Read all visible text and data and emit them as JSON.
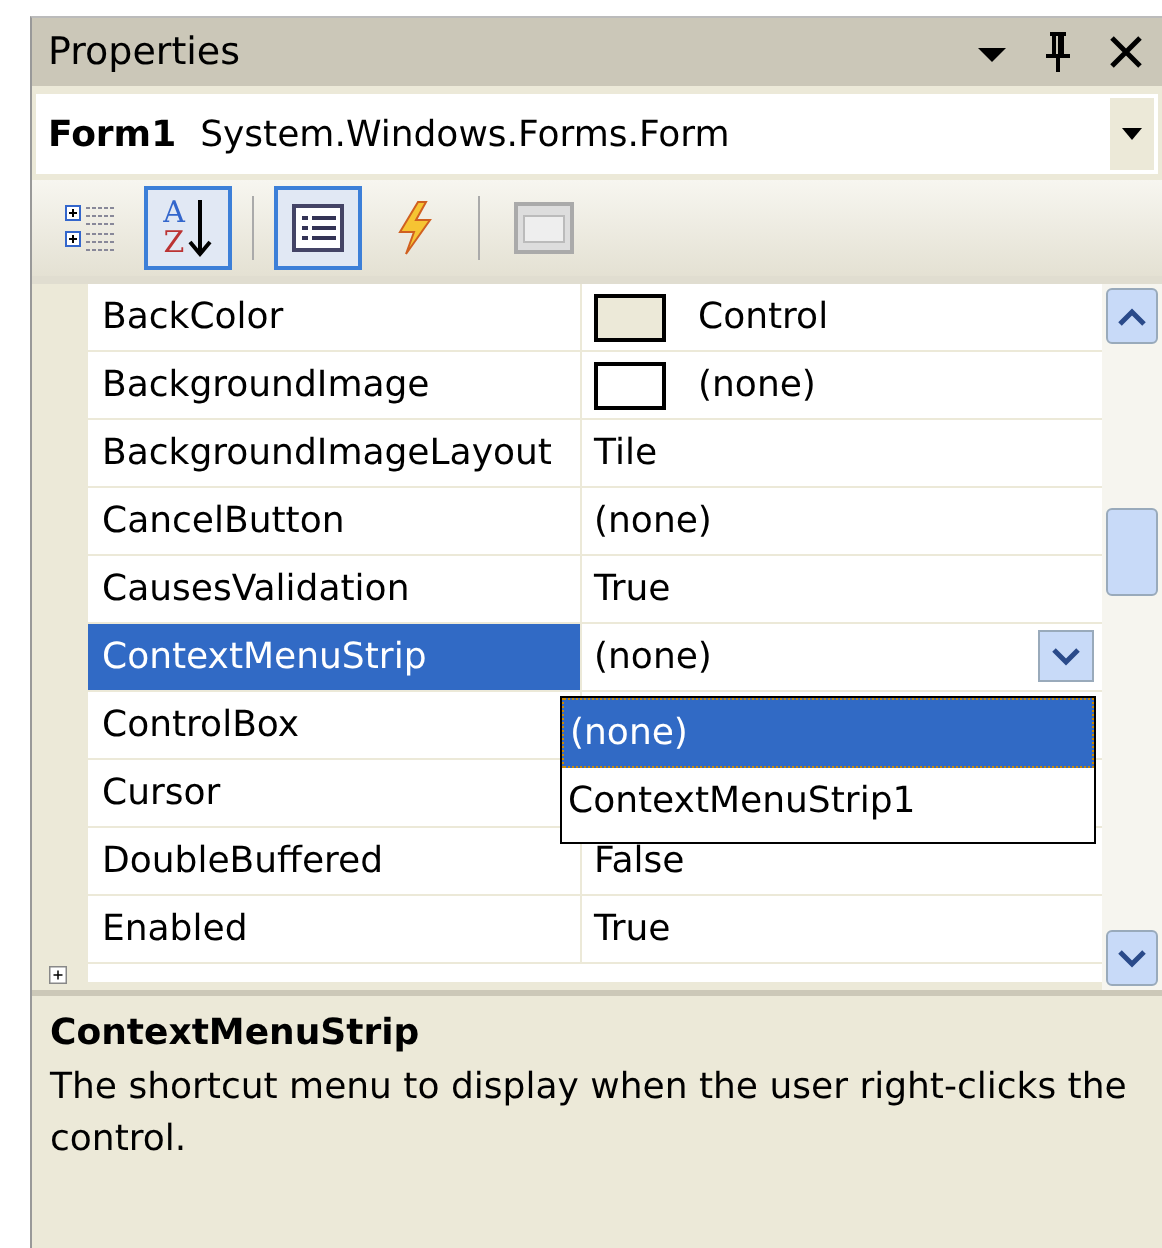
{
  "window": {
    "title": "Properties"
  },
  "object_selector": {
    "name": "Form1",
    "type": "System.Windows.Forms.Form"
  },
  "toolbar": [
    {
      "kind": "categorized",
      "selected": false
    },
    {
      "kind": "alphabetical",
      "selected": true,
      "letters": [
        "A",
        "Z"
      ]
    },
    {
      "kind": "separator"
    },
    {
      "kind": "properties",
      "selected": true
    },
    {
      "kind": "events",
      "selected": false
    },
    {
      "kind": "separator"
    },
    {
      "kind": "pages",
      "selected": false
    }
  ],
  "properties": [
    {
      "name": "BackColor",
      "value": "Control",
      "kind": "color",
      "color": "#ece9d8",
      "selected": false
    },
    {
      "name": "BackgroundImage",
      "value": "(none)",
      "kind": "image",
      "selected": false
    },
    {
      "name": "BackgroundImageLayout",
      "value": "Tile",
      "kind": "text",
      "selected": false
    },
    {
      "name": "CancelButton",
      "value": "(none)",
      "kind": "text",
      "selected": false
    },
    {
      "name": "CausesValidation",
      "value": "True",
      "kind": "text",
      "selected": false
    },
    {
      "name": "ContextMenuStrip",
      "value": "(none)",
      "kind": "dropdown",
      "selected": true
    },
    {
      "name": "ControlBox",
      "kind": "text",
      "selected": false
    },
    {
      "name": "Cursor",
      "kind": "text",
      "selected": false
    },
    {
      "name": "DoubleBuffered",
      "value": "False",
      "kind": "text",
      "selected": false
    },
    {
      "name": "Enabled",
      "value": "True",
      "kind": "text",
      "selected": false
    },
    {
      "kind": "expandable",
      "expanded": false,
      "selected": false
    }
  ],
  "dropdown_list": [
    {
      "label": "(none)",
      "selected": true
    },
    {
      "label": "ContextMenuStrip1",
      "selected": false
    }
  ],
  "description": {
    "title": "ContextMenuStrip",
    "text": "The shortcut menu to display when the user right-clicks the control."
  }
}
